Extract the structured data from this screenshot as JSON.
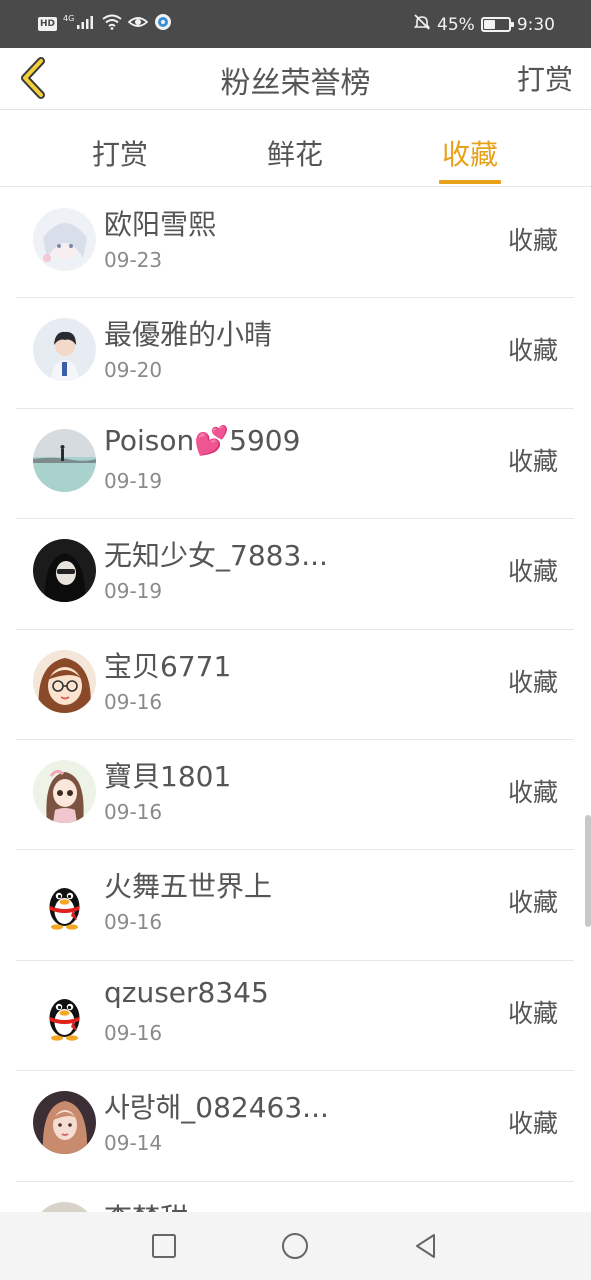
{
  "status_bar": {
    "hd_label": "HD",
    "network_label": "4G",
    "battery_percent": "45%",
    "battery_level": 0.45,
    "time": "9:30",
    "icons": [
      "hd-icon",
      "signal-icon",
      "wifi-icon",
      "eye-icon",
      "app-notification-icon",
      "mute-icon",
      "battery-icon"
    ]
  },
  "nav": {
    "back_icon": "chevron-left-icon",
    "title": "粉丝荣誉榜",
    "right_action": "打赏"
  },
  "tabs": [
    {
      "label": "打赏",
      "active": false
    },
    {
      "label": "鲜花",
      "active": false
    },
    {
      "label": "收藏",
      "active": true
    }
  ],
  "accent_color": "#e8a21a",
  "list": [
    {
      "name": "欧阳雪熙",
      "date": "09-23",
      "action": "收藏",
      "avatar": "anime-avatar"
    },
    {
      "name": "最優雅的小晴",
      "date": "09-20",
      "action": "收藏",
      "avatar": "photo-avatar"
    },
    {
      "name": "Poison💕5909",
      "date": "09-19",
      "action": "收藏",
      "avatar": "landscape-avatar"
    },
    {
      "name": "无知少女_7883...",
      "date": "09-19",
      "action": "收藏",
      "avatar": "photo-avatar"
    },
    {
      "name": "宝贝6771",
      "date": "09-16",
      "action": "收藏",
      "avatar": "cartoon-girl-avatar"
    },
    {
      "name": "寶貝1801",
      "date": "09-16",
      "action": "收藏",
      "avatar": "doll-avatar"
    },
    {
      "name": "火舞五世界上",
      "date": "09-16",
      "action": "收藏",
      "avatar": "penguin-avatar"
    },
    {
      "name": "qzuser8345",
      "date": "09-16",
      "action": "收藏",
      "avatar": "penguin-avatar"
    },
    {
      "name": "사랑해_082463...",
      "date": "09-14",
      "action": "收藏",
      "avatar": "photo-avatar"
    },
    {
      "name": "李梦甜",
      "date": "",
      "action": "",
      "avatar": "photo-avatar"
    }
  ],
  "system_nav": {
    "icons": [
      "recent-apps-icon",
      "home-icon",
      "back-icon"
    ]
  }
}
